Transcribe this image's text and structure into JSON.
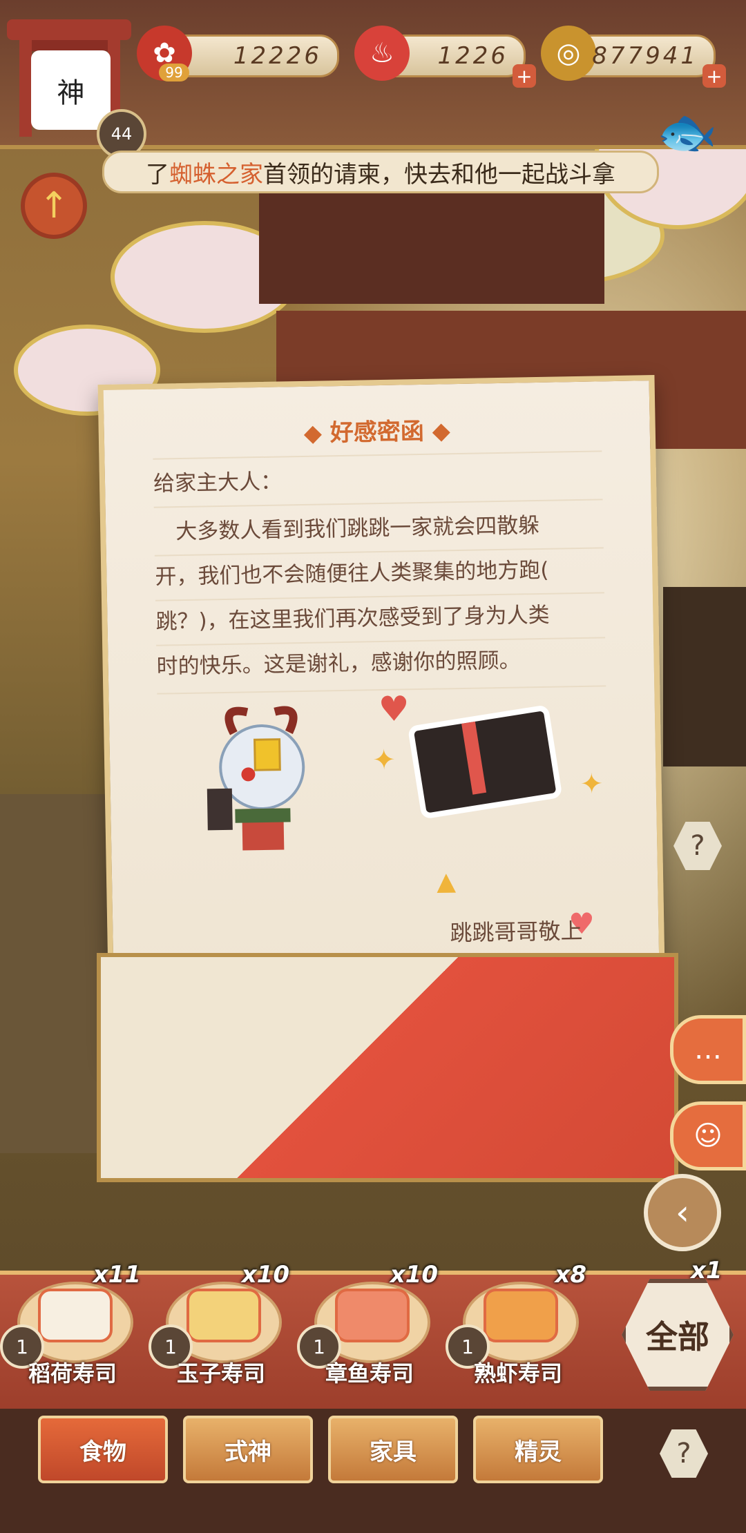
{
  "hud": {
    "avatar_label": "神",
    "level": "44",
    "resources": [
      {
        "icon": "flower-icon",
        "value": "12226",
        "badge": "99"
      },
      {
        "icon": "stamina-icon",
        "value": "1226"
      },
      {
        "icon": "coin-icon",
        "value": "877941"
      }
    ]
  },
  "ticker": {
    "prefix": "了",
    "highlight": "蜘蛛之家",
    "suffix": "首领的请柬，快去和他一起战斗拿"
  },
  "letter": {
    "title": "◆ 好感密函 ◆",
    "greeting": "给家主大人：",
    "body_lines": [
      "　大多数人看到我们跳跳一家就会四散躲",
      "开，我们也不会随便往人类聚集的地方跑(",
      "跳？)，在这里我们再次感受到了身为人类",
      "时的快乐。这是谢礼，感谢你的照顾。"
    ],
    "signature": "跳跳哥哥敬上"
  },
  "food_items": [
    {
      "name": "稻荷寿司",
      "count": "x11",
      "level": "1"
    },
    {
      "name": "玉子寿司",
      "count": "x10",
      "level": "1"
    },
    {
      "name": "章鱼寿司",
      "count": "x10",
      "level": "1"
    },
    {
      "name": "熟虾寿司",
      "count": "x8",
      "level": "1"
    }
  ],
  "all_button": {
    "label": "全部",
    "count": "x1"
  },
  "tabs": [
    "食物",
    "式神",
    "家具",
    "精灵"
  ],
  "colors": {
    "accent": "#e56d3e",
    "letter_title": "#d2692f",
    "hud_bg": "#6b3e2d"
  }
}
